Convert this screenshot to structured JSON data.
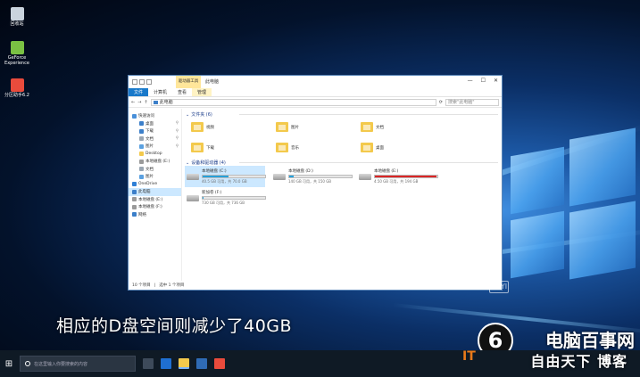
{
  "desktop": {
    "icons": [
      {
        "label": "回收站",
        "color": "#c9d3dd"
      },
      {
        "label": "GeForce Experience",
        "color": "#7ac143"
      },
      {
        "label": "分区助手6.2",
        "color": "#e94b3c"
      }
    ]
  },
  "window": {
    "context_tab": "驱动器工具",
    "title": "此电脑",
    "ribbon_tabs": [
      "文件",
      "计算机",
      "查看",
      "管理"
    ],
    "address": "此电脑",
    "search_placeholder": "搜索\"此电脑\"",
    "nav": [
      {
        "label": "快速访问",
        "level": 0,
        "pinned": false,
        "color": "#4a90d9"
      },
      {
        "label": "桌面",
        "level": 1,
        "pinned": true,
        "color": "#3c7fc9"
      },
      {
        "label": "下载",
        "level": 1,
        "pinned": true,
        "color": "#3c7fc9"
      },
      {
        "label": "文档",
        "level": 1,
        "pinned": true,
        "color": "#9aa6b2"
      },
      {
        "label": "图片",
        "level": 1,
        "pinned": true,
        "color": "#5aa0e0"
      },
      {
        "label": "Desktop",
        "level": 1,
        "pinned": false,
        "color": "#f3c94c"
      },
      {
        "label": "本地磁盘 (E:)",
        "level": 1,
        "pinned": false,
        "color": "#9a9a9a"
      },
      {
        "label": "文档",
        "level": 1,
        "pinned": false,
        "color": "#9aa6b2"
      },
      {
        "label": "图片",
        "level": 1,
        "pinned": false,
        "color": "#5aa0e0"
      },
      {
        "label": "OneDrive",
        "level": 0,
        "pinned": false,
        "color": "#2f7fd6"
      },
      {
        "label": "此电脑",
        "level": 0,
        "pinned": false,
        "color": "#3c7fc9"
      },
      {
        "label": "本地磁盘 (E:)",
        "level": 0,
        "pinned": false,
        "color": "#9a9a9a"
      },
      {
        "label": "本地磁盘 (F:)",
        "level": 0,
        "pinned": false,
        "color": "#9a9a9a"
      },
      {
        "label": "网络",
        "level": 0,
        "pinned": false,
        "color": "#3c7fc9"
      }
    ],
    "selected_nav": "此电脑",
    "folders_header": "文件夹 (6)",
    "folders": [
      "视频",
      "图片",
      "文档",
      "下载",
      "音乐",
      "桌面"
    ],
    "devices_header": "设备和驱动器 (4)",
    "drives": [
      {
        "name": "本地磁盘 (C:)",
        "size_text": "40.5 GB 可用，共 70.0 GB",
        "used_fraction": 0.42,
        "color": "#26a0da",
        "selected": true
      },
      {
        "name": "本地磁盘 (D:)",
        "size_text": "140 GB 可用，共 150 GB",
        "used_fraction": 0.07,
        "color": "#26a0da",
        "selected": false
      },
      {
        "name": "本地磁盘 (E:)",
        "size_text": "4.50 GB 可用，共 194 GB",
        "used_fraction": 0.98,
        "color": "#da2626",
        "selected": false
      },
      {
        "name": "新加卷 (F:)",
        "size_text": "730 GB 可用，共 736 GB",
        "used_fraction": 0.01,
        "color": "#26a0da",
        "selected": false
      }
    ],
    "status": {
      "items": "10 个项目",
      "selected": "选中 1 个项目"
    }
  },
  "subtitle": "相应的D盘空间则减少了40GB",
  "watermark": {
    "brand": "电脑百事网",
    "sub": "自由天下 博客",
    "logo": "6",
    "it": "IT",
    "iqiyi": "iQIYI"
  },
  "taskbar": {
    "search_placeholder": "在这里输入你要搜索的内容"
  }
}
